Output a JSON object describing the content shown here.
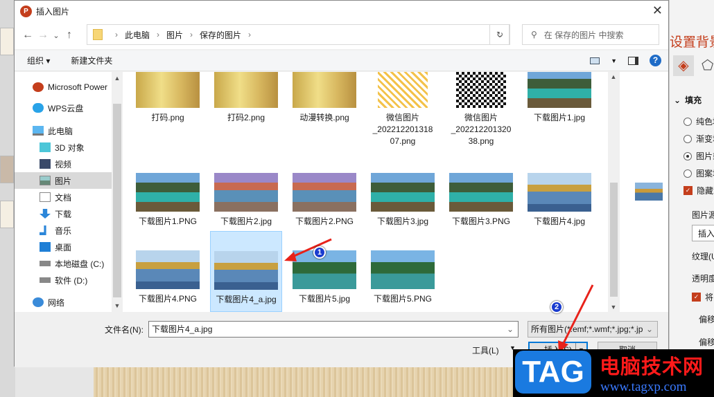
{
  "dialog": {
    "title": "插入图片",
    "close": "✕"
  },
  "nav": {
    "back": "←",
    "forward": "→",
    "recent": "⌄",
    "up": "↑",
    "breadcrumb": [
      "此电脑",
      "图片",
      "保存的图片"
    ],
    "refresh": "↻",
    "search_placeholder": "在 保存的图片 中搜索"
  },
  "toolbar": {
    "organize": "组织 ▾",
    "new_folder": "新建文件夹",
    "help": "?"
  },
  "sidebar": {
    "items": [
      {
        "label": "Microsoft Power",
        "icon": "powerpoint-icon"
      },
      {
        "label": "WPS云盘",
        "icon": "cloud-icon"
      },
      {
        "label": "此电脑",
        "icon": "computer-icon"
      },
      {
        "label": "3D 对象",
        "icon": "cube-icon"
      },
      {
        "label": "视频",
        "icon": "video-icon"
      },
      {
        "label": "图片",
        "icon": "pictures-icon",
        "selected": true
      },
      {
        "label": "文档",
        "icon": "document-icon"
      },
      {
        "label": "下载",
        "icon": "download-icon"
      },
      {
        "label": "音乐",
        "icon": "music-icon"
      },
      {
        "label": "桌面",
        "icon": "desktop-icon"
      },
      {
        "label": "本地磁盘 (C:)",
        "icon": "drive-icon"
      },
      {
        "label": "软件 (D:)",
        "icon": "drive-icon"
      },
      {
        "label": "网络",
        "icon": "network-icon"
      }
    ]
  },
  "files": [
    {
      "name": "打码.png",
      "thumb": "girl"
    },
    {
      "name": "打码2.png",
      "thumb": "girl"
    },
    {
      "name": "动漫转换.png",
      "thumb": "girl"
    },
    {
      "name": "微信图片_20221220131807.png",
      "line1": "微信图片",
      "line2": "_202212201318",
      "line3": "07.png",
      "thumb": "qr-yellow"
    },
    {
      "name": "微信图片_20221220132038.png",
      "line1": "微信图片",
      "line2": "_202212201320",
      "line3": "38.png",
      "thumb": "qr-black"
    },
    {
      "name": "下载图片1.jpg",
      "thumb": "lake"
    },
    {
      "name": "下载图片1.PNG",
      "thumb": "lake"
    },
    {
      "name": "下载图片2.jpg",
      "thumb": "falls"
    },
    {
      "name": "下载图片2.PNG",
      "thumb": "falls"
    },
    {
      "name": "下载图片3.jpg",
      "thumb": "lake"
    },
    {
      "name": "下载图片3.PNG",
      "thumb": "lake"
    },
    {
      "name": "下载图片4.jpg",
      "thumb": "reflect"
    },
    {
      "name": "下载图片4.PNG",
      "thumb": "reflect"
    },
    {
      "name": "下载图片4_a.jpg",
      "thumb": "reflect",
      "selected": true
    },
    {
      "name": "下载图片5.jpg",
      "thumb": "valley"
    },
    {
      "name": "下载图片5.PNG",
      "thumb": "valley"
    }
  ],
  "bottom": {
    "filename_label": "文件名(N):",
    "filename_value": "下载图片4_a.jpg",
    "filter": "所有图片(*.emf;*.wmf;*.jpg;*.jp",
    "tools": "工具(L)",
    "insert": "插入(S)",
    "cancel": "取消"
  },
  "panel": {
    "title": "设置背景格式",
    "section": "填充",
    "options": [
      "纯色填充",
      "渐变填充",
      "图片或纹理填充",
      "图案填充"
    ],
    "hide": "隐藏背景图形",
    "source": "图片源",
    "insert": "插入",
    "texture": "纹理(U)",
    "transparency": "透明度",
    "tile": "将图片平铺为纹理",
    "offset1": "偏移量",
    "offset2": "偏移量"
  },
  "annotations": {
    "one": "1",
    "two": "2"
  },
  "watermark": {
    "tag": "TAG",
    "site": "电脑技术网",
    "url": "www.tagxp.com"
  },
  "colors": {
    "accent": "#0078d7",
    "selection": "#cce8ff",
    "ppt": "#c43e1c"
  }
}
